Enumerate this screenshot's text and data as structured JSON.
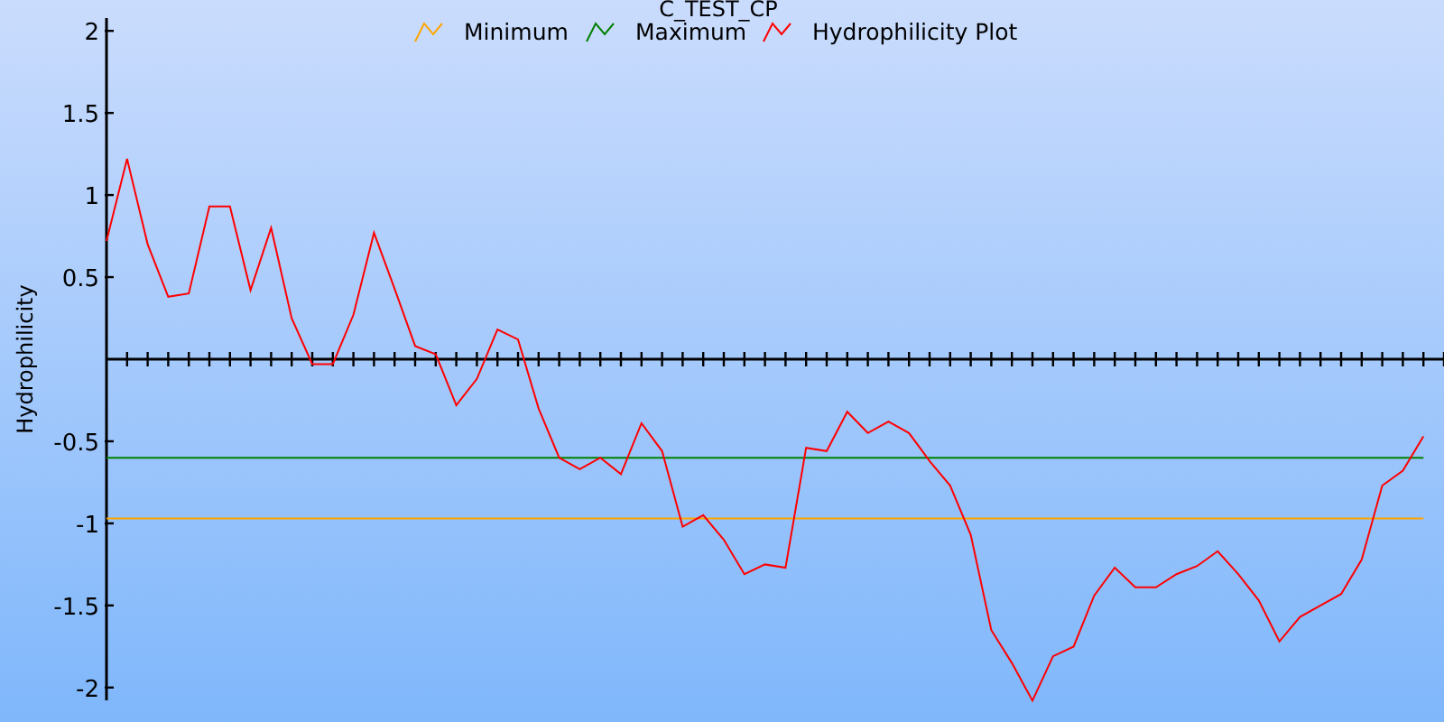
{
  "chart_data": {
    "type": "line",
    "title": "C_TEST_CP",
    "ylabel": "Hydrophilicity",
    "legend": "top",
    "ylim": [
      -2.1,
      2.1
    ],
    "yticks": [
      {
        "value": 2,
        "label": "2"
      },
      {
        "value": 1.5,
        "label": "1.5"
      },
      {
        "value": 1,
        "label": "1"
      },
      {
        "value": 0.5,
        "label": "0.5"
      },
      {
        "value": -0.5,
        "label": "-0.5"
      },
      {
        "value": -1,
        "label": "-1"
      },
      {
        "value": -1.5,
        "label": "-1.5"
      },
      {
        "value": -2,
        "label": "-2"
      }
    ],
    "categories": [
      null,
      null,
      null,
      null,
      null,
      null,
      null,
      null,
      null,
      null,
      null,
      null,
      null,
      null,
      null,
      null,
      null,
      null,
      null,
      null,
      null,
      null,
      null,
      null,
      null,
      null,
      null,
      null,
      null,
      null,
      null,
      null,
      null,
      null,
      null,
      null,
      null,
      null,
      null,
      null,
      null,
      null,
      null,
      null,
      null,
      null,
      null,
      null,
      null,
      null,
      null,
      null,
      null,
      null,
      null,
      null,
      null,
      null,
      null,
      null,
      null,
      null,
      null,
      null,
      null
    ],
    "series": [
      {
        "name": "Minimum",
        "color": "#ffa500",
        "values": [
          -0.97,
          -0.97,
          -0.97,
          -0.97,
          -0.97,
          -0.97,
          -0.97,
          -0.97,
          -0.97,
          -0.97,
          -0.97,
          -0.97,
          -0.97,
          -0.97,
          -0.97,
          -0.97,
          -0.97,
          -0.97,
          -0.97,
          -0.97,
          -0.97,
          -0.97,
          -0.97,
          -0.97,
          -0.97,
          -0.97,
          -0.97,
          -0.97,
          -0.97,
          -0.97,
          -0.97,
          -0.97,
          -0.97,
          -0.97,
          -0.97,
          -0.97,
          -0.97,
          -0.97,
          -0.97,
          -0.97,
          -0.97,
          -0.97,
          -0.97,
          -0.97,
          -0.97,
          -0.97,
          -0.97,
          -0.97,
          -0.97,
          -0.97,
          -0.97,
          -0.97,
          -0.97,
          -0.97,
          -0.97,
          -0.97,
          -0.97,
          -0.97,
          -0.97,
          -0.97,
          -0.97,
          -0.97,
          -0.97,
          -0.97,
          -0.97
        ]
      },
      {
        "name": "Maximum",
        "color": "#008000",
        "values": [
          -0.6,
          -0.6,
          -0.6,
          -0.6,
          -0.6,
          -0.6,
          -0.6,
          -0.6,
          -0.6,
          -0.6,
          -0.6,
          -0.6,
          -0.6,
          -0.6,
          -0.6,
          -0.6,
          -0.6,
          -0.6,
          -0.6,
          -0.6,
          -0.6,
          -0.6,
          -0.6,
          -0.6,
          -0.6,
          -0.6,
          -0.6,
          -0.6,
          -0.6,
          -0.6,
          -0.6,
          -0.6,
          -0.6,
          -0.6,
          -0.6,
          -0.6,
          -0.6,
          -0.6,
          -0.6,
          -0.6,
          -0.6,
          -0.6,
          -0.6,
          -0.6,
          -0.6,
          -0.6,
          -0.6,
          -0.6,
          -0.6,
          -0.6,
          -0.6,
          -0.6,
          -0.6,
          -0.6,
          -0.6,
          -0.6,
          -0.6,
          -0.6,
          -0.6,
          -0.6,
          -0.6,
          -0.6,
          -0.6,
          -0.6,
          -0.6
        ]
      },
      {
        "name": "Hydrophilicity Plot",
        "color": "#ff0000",
        "values": [
          0.72,
          1.22,
          0.7,
          0.38,
          0.4,
          0.93,
          0.93,
          0.42,
          0.8,
          0.25,
          -0.03,
          -0.03,
          0.27,
          0.77,
          0.43,
          0.08,
          0.03,
          -0.28,
          -0.12,
          0.18,
          0.12,
          -0.3,
          -0.6,
          -0.67,
          -0.6,
          -0.7,
          -0.39,
          -0.56,
          -1.02,
          -0.95,
          -1.1,
          -1.31,
          -1.25,
          -1.27,
          -0.54,
          -0.56,
          -0.32,
          -0.45,
          -0.38,
          -0.45,
          -0.62,
          -0.77,
          -1.07,
          -1.65,
          -1.85,
          -2.08,
          -1.81,
          -1.75,
          -1.44,
          -1.27,
          -1.39,
          -1.39,
          -1.31,
          -1.26,
          -1.17,
          -1.31,
          -1.47,
          -1.72,
          -1.57,
          -1.5,
          -1.43,
          -1.22,
          -0.77,
          -0.68,
          -0.47
        ]
      }
    ]
  }
}
